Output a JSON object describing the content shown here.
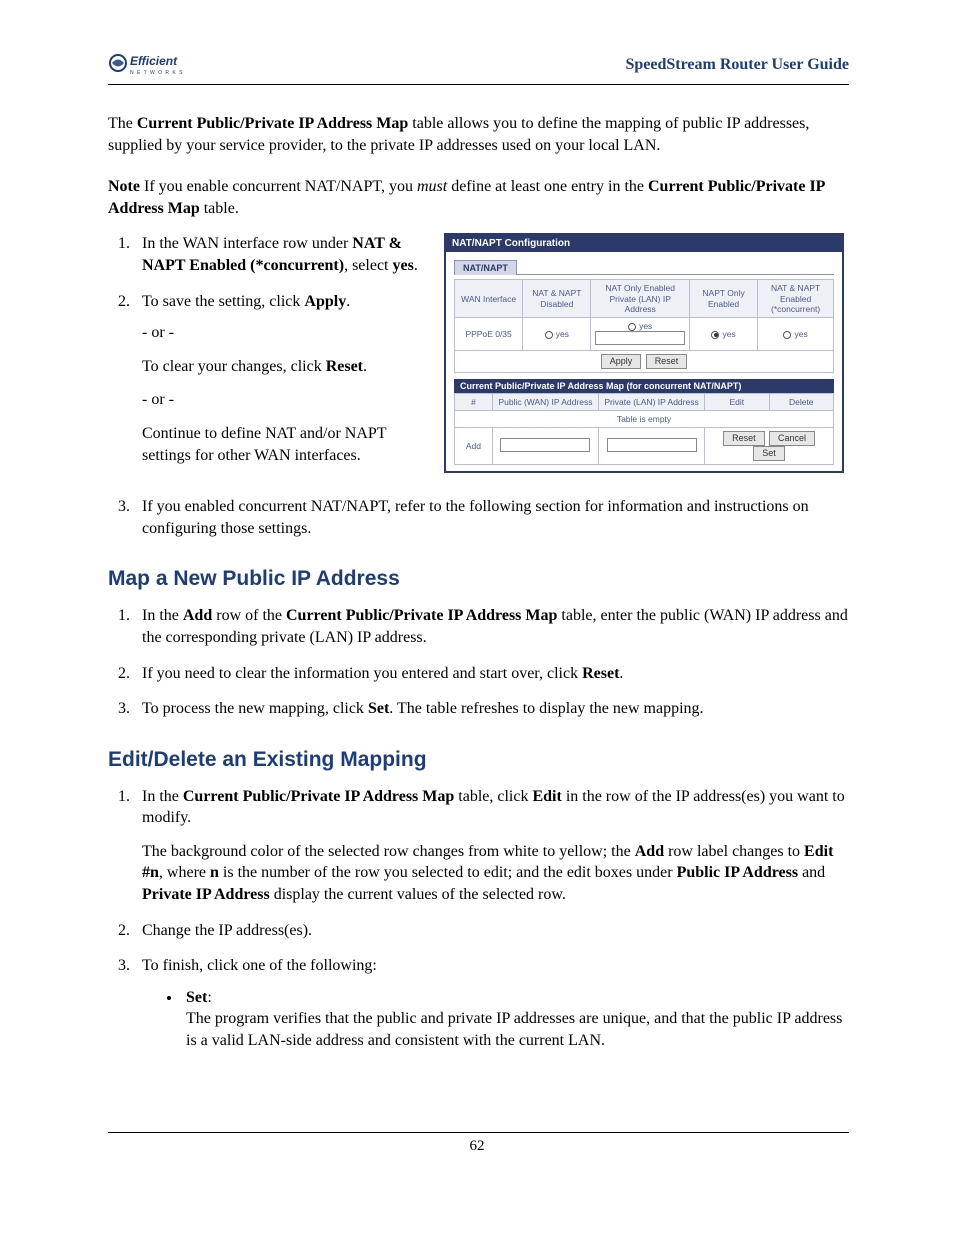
{
  "header": {
    "logo_text": "Efficient",
    "logo_sub": "N E T W O R K S",
    "doc_title": "SpeedStream Router User Guide"
  },
  "intro": {
    "text_before_bold": "The ",
    "bold1": "Current Public/Private IP Address Map",
    "text_after": " table allows you to define the mapping of public IP addresses, supplied by your service provider, to the private IP addresses used on your local LAN."
  },
  "note": {
    "label": "Note",
    "t1": "  If you enable concurrent NAT/NAPT, you ",
    "italic": "must",
    "t2": " define at least one entry in the ",
    "bold": "Current Public/Private IP Address Map",
    "t3": " table."
  },
  "steps_left": {
    "s1_a": "In the WAN interface row under ",
    "s1_b": "NAT & NAPT Enabled (*concurrent)",
    "s1_c": ", select ",
    "s1_d": "yes",
    "s1_e": ".",
    "s2_a": "To save the setting, click ",
    "s2_b": "Apply",
    "s2_c": ".",
    "or": "- or -",
    "s2_clear_a": "To clear your changes, click ",
    "s2_clear_b": "Reset",
    "s2_clear_c": ".",
    "s2_cont": "Continue to define NAT and/or NAPT settings for other WAN interfaces."
  },
  "step3": {
    "text": "If you enabled concurrent NAT/NAPT, refer to the following section for information and instructions on configuring those settings."
  },
  "h_map": "Map a New Public IP Address",
  "map_steps": {
    "s1_a": "In the ",
    "s1_b": "Add",
    "s1_c": " row of the ",
    "s1_d": "Current Public/Private IP Address Map",
    "s1_e": " table, enter the public (WAN) IP address and the corresponding private (LAN) IP address.",
    "s2_a": "If you need to clear the information you entered and start over, click ",
    "s2_b": "Reset",
    "s2_c": ".",
    "s3_a": "To process the new mapping, click ",
    "s3_b": "Set",
    "s3_c": ". The table refreshes to display the new mapping."
  },
  "h_edit": "Edit/Delete an Existing Mapping",
  "edit_steps": {
    "s1_a": "In the ",
    "s1_b": "Current Public/Private IP Address Map",
    "s1_c": " table, click ",
    "s1_d": "Edit",
    "s1_e": " in the row of the IP address(es) you want to modify.",
    "s1_bg_a": "The background color of the selected row changes from white to yellow; the ",
    "s1_bg_b": "Add",
    "s1_bg_c": " row label changes to ",
    "s1_bg_d": "Edit #n",
    "s1_bg_e": ", where ",
    "s1_bg_f": "n",
    "s1_bg_g": " is the number of the row you selected to edit; and the edit boxes under ",
    "s1_bg_h": "Public IP Address",
    "s1_bg_i": " and ",
    "s1_bg_j": "Private IP Address",
    "s1_bg_k": " display the current values of the selected row.",
    "s2": "Change the IP address(es).",
    "s3": "To finish, click one of the following:",
    "bullet_set": "Set",
    "bullet_set_desc": "The program verifies that the public and private IP addresses are unique, and that the public IP address is a valid LAN-side address and consistent with the current LAN."
  },
  "footer": {
    "page": "62"
  },
  "config": {
    "title": "NAT/NAPT Configuration",
    "tab": "NAT/NAPT",
    "cols": {
      "c1": "WAN Interface",
      "c2": "NAT & NAPT Disabled",
      "c3": "NAT Only Enabled Private (LAN) IP Address",
      "c4": "NAPT Only Enabled",
      "c5": "NAT & NAPT Enabled (*concurrent)"
    },
    "row": {
      "iface": "PPPoE 0/35",
      "yes": "yes"
    },
    "apply": "Apply",
    "reset": "Reset",
    "sec2": "Current Public/Private IP Address Map (for concurrent NAT/NAPT)",
    "map_cols": {
      "c1": "#",
      "c2": "Public (WAN) IP Address",
      "c3": "Private (LAN) IP Address",
      "c4": "Edit",
      "c5": "Delete"
    },
    "empty": "Table is empty",
    "add": "Add",
    "cancel": "Cancel",
    "set": "Set"
  }
}
